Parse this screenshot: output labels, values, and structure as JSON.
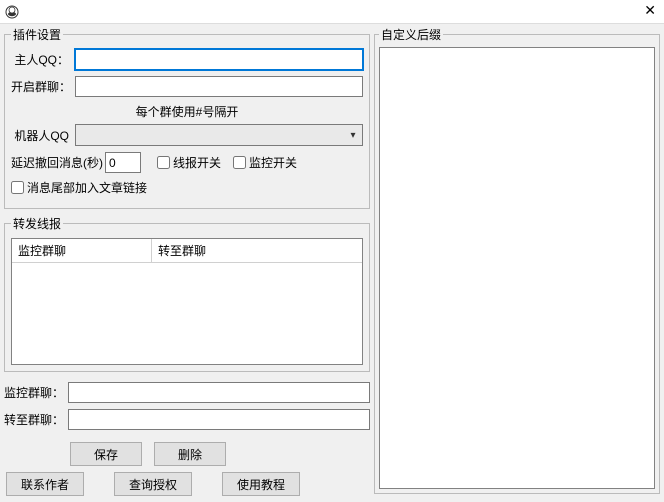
{
  "titlebar": {
    "close": "✕"
  },
  "plugin": {
    "legend": "插件设置",
    "master_label": "主人QQ：",
    "master_value": "",
    "open_group_label": "开启群聊：",
    "open_group_value": "",
    "hint": "每个群使用#号隔开",
    "robot_label": "机器人QQ",
    "robot_value": "",
    "delay_label": "延迟撤回消息(秒)",
    "delay_value": "0",
    "xianbao_switch": "线报开关",
    "monitor_switch": "监控开关",
    "tail_link": "消息尾部加入文章链接"
  },
  "forward": {
    "legend": "转发线报",
    "col1": "监控群聊",
    "col2": "转至群聊",
    "mon_label": "监控群聊：",
    "mon_value": "",
    "to_label": "转至群聊：",
    "to_value": "",
    "save": "保存",
    "delete": "删除"
  },
  "bottom": {
    "contact": "联系作者",
    "auth": "查询授权",
    "tutorial": "使用教程"
  },
  "suffix": {
    "legend": "自定义后缀"
  }
}
